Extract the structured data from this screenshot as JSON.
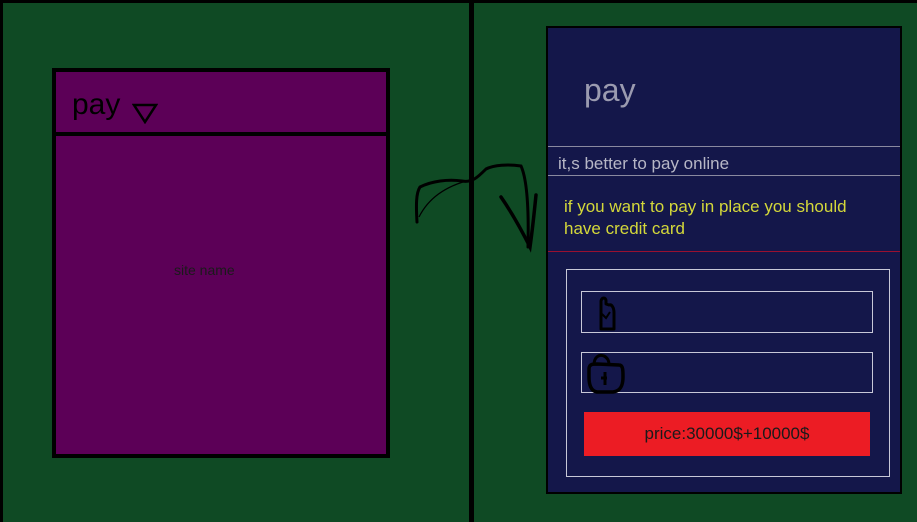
{
  "left_panel": {
    "title": "pay",
    "dropdown_icon": "triangle-down-icon",
    "site_name": "site name"
  },
  "arrow": {
    "icon": "hand-drawn-arrow-icon"
  },
  "right_panel": {
    "title": "pay",
    "subtitle": "it,s better to pay online",
    "info": "if you want to pay in place you should have credit card",
    "user_field": {
      "value": "",
      "icon": "user-icon"
    },
    "password_field": {
      "value": "",
      "icon": "lock-icon"
    },
    "price_button_label": "price:30000$+10000$"
  },
  "colors": {
    "background": "#0f4a24",
    "left_panel": "#5c0057",
    "right_panel": "#14174a",
    "info_text": "#d4d83a",
    "button": "#ec1c24"
  }
}
